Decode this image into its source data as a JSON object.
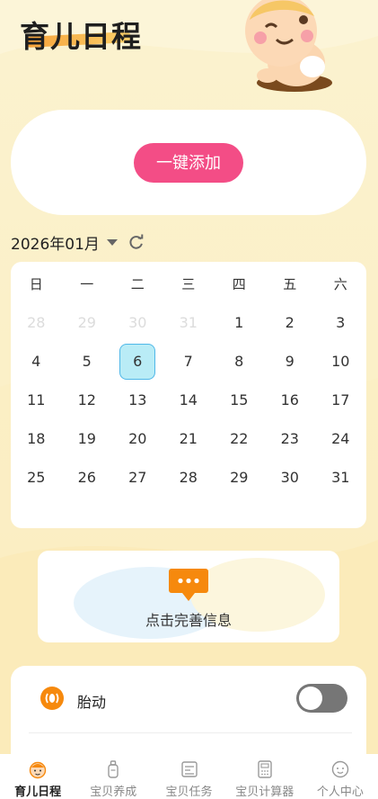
{
  "app": {
    "title": "育儿日程"
  },
  "add_card": {
    "button_label": "一键添加"
  },
  "calendar": {
    "month_label": "2026年01月",
    "weekdays": [
      "日",
      "一",
      "二",
      "三",
      "四",
      "五",
      "六"
    ],
    "weeks": [
      [
        {
          "d": "28",
          "dim": true
        },
        {
          "d": "29",
          "dim": true
        },
        {
          "d": "30",
          "dim": true
        },
        {
          "d": "31",
          "dim": true
        },
        {
          "d": "1"
        },
        {
          "d": "2"
        },
        {
          "d": "3"
        }
      ],
      [
        {
          "d": "4"
        },
        {
          "d": "5"
        },
        {
          "d": "6",
          "today": true
        },
        {
          "d": "7"
        },
        {
          "d": "8"
        },
        {
          "d": "9"
        },
        {
          "d": "10"
        }
      ],
      [
        {
          "d": "11"
        },
        {
          "d": "12"
        },
        {
          "d": "13"
        },
        {
          "d": "14"
        },
        {
          "d": "15"
        },
        {
          "d": "16"
        },
        {
          "d": "17"
        }
      ],
      [
        {
          "d": "18"
        },
        {
          "d": "19"
        },
        {
          "d": "20"
        },
        {
          "d": "21"
        },
        {
          "d": "22"
        },
        {
          "d": "23"
        },
        {
          "d": "24"
        }
      ],
      [
        {
          "d": "25"
        },
        {
          "d": "26"
        },
        {
          "d": "27"
        },
        {
          "d": "28"
        },
        {
          "d": "29"
        },
        {
          "d": "30"
        },
        {
          "d": "31"
        }
      ]
    ]
  },
  "info_card": {
    "text": "点击完善信息",
    "icon": "chat-bubble-icon"
  },
  "settings": {
    "fetal_movement_label": "胎动",
    "fetal_movement_enabled": false
  },
  "tabs": [
    {
      "label": "育儿日程",
      "icon": "baby-face-icon",
      "active": true
    },
    {
      "label": "宝贝养成",
      "icon": "bottle-icon",
      "active": false
    },
    {
      "label": "宝贝任务",
      "icon": "task-list-icon",
      "active": false
    },
    {
      "label": "宝贝计算器",
      "icon": "calculator-icon",
      "active": false
    },
    {
      "label": "个人中心",
      "icon": "smiley-icon",
      "active": false
    }
  ],
  "colors": {
    "accent_pink": "#f34d86",
    "accent_orange": "#f6890d",
    "today_bg": "#b9ecf6"
  }
}
